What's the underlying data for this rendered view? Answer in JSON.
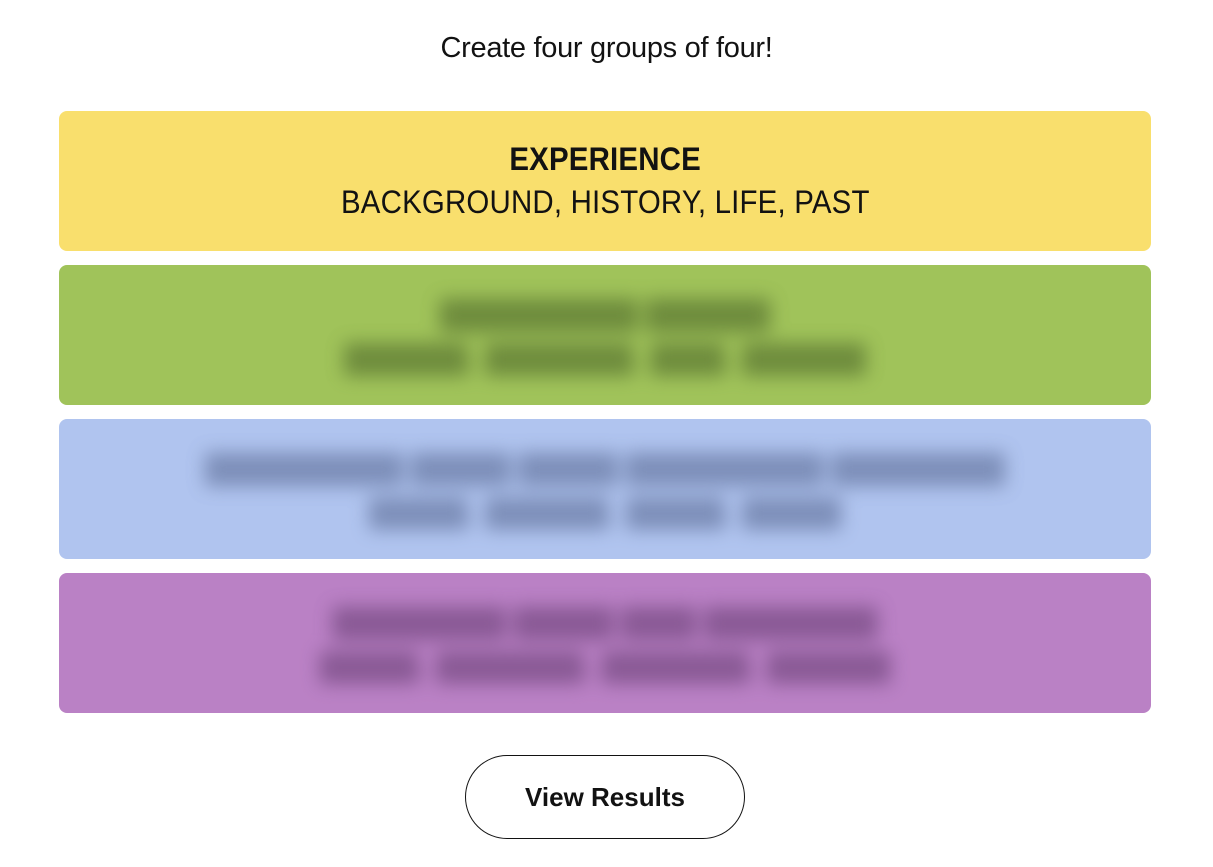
{
  "instructions": "Create four groups of four!",
  "groups": [
    {
      "status": "revealed",
      "color": "#f9df6d",
      "category": "EXPERIENCE",
      "members": "BACKGROUND, HISTORY, LIFE, PAST"
    },
    {
      "status": "hidden",
      "color": "#a0c35a",
      "text_color": "#5e7a34"
    },
    {
      "status": "hidden",
      "color": "#b0c4ef",
      "text_color": "#6d7ea8"
    },
    {
      "status": "hidden",
      "color": "#ba81c5",
      "text_color": "#7a4d86"
    }
  ],
  "actions": {
    "view_results_label": "View Results"
  }
}
